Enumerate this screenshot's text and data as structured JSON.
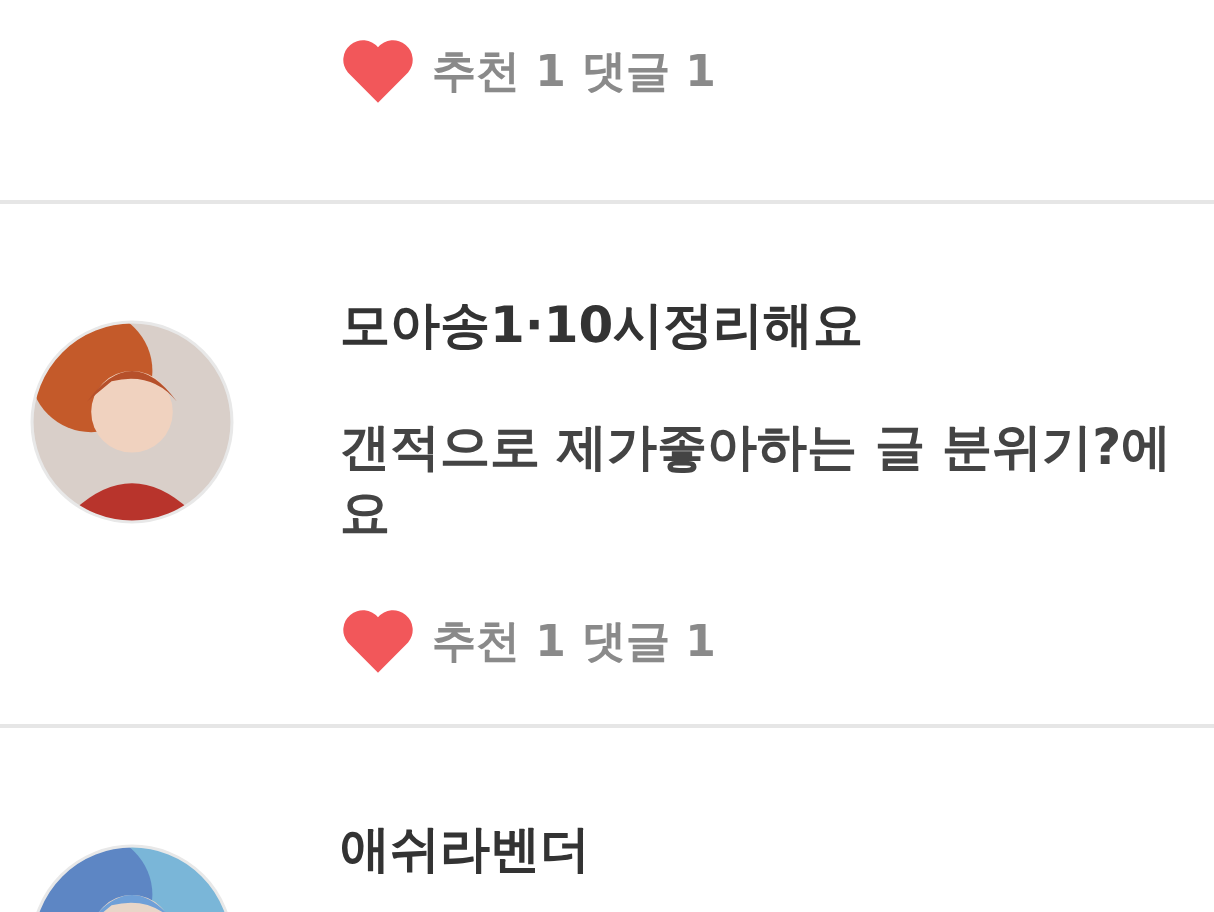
{
  "posts": [
    {
      "recommend": "추천 1",
      "comments": "댓글 1"
    },
    {
      "author": "모아송1·10시정리해요",
      "body": "갠적으로 제가좋아하는 글 분위기?에요",
      "recommend": "추천 1",
      "comments": "댓글 1"
    },
    {
      "author": "애쉬라벤더"
    }
  ]
}
